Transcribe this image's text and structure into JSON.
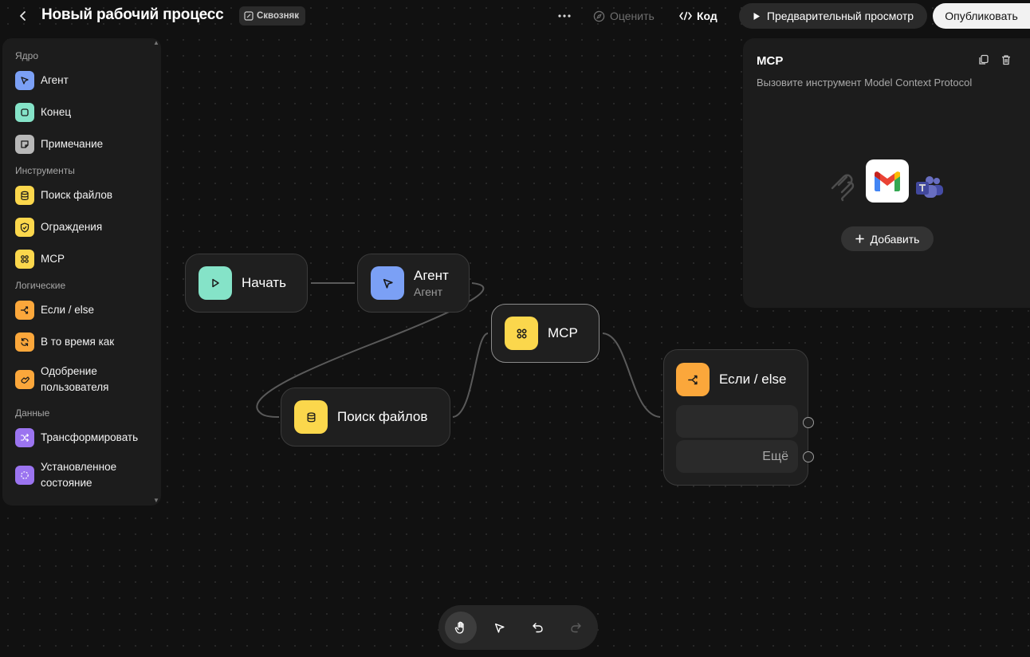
{
  "header": {
    "title": "Новый рабочий процесс",
    "badge": "Сквозняк",
    "rate_label": "Оценить",
    "code_label": "Код",
    "preview_label": "Предварительный просмотр",
    "publish_label": "Опубликовать"
  },
  "sidebar": {
    "sections": {
      "core": "Ядро",
      "tools": "Инструменты",
      "logic": "Логические",
      "data": "Данные"
    },
    "items": [
      {
        "label": "Агент",
        "icon": "cursor-icon",
        "color": "#7ba0f5"
      },
      {
        "label": "Конец",
        "icon": "stop-square-icon",
        "color": "#85e3c8"
      },
      {
        "label": "Примечание",
        "icon": "note-icon",
        "color": "#b8b8b8"
      },
      {
        "label": "Поиск файлов",
        "icon": "database-icon",
        "color": "#fbd74c"
      },
      {
        "label": "Ограждения",
        "icon": "shield-icon",
        "color": "#fbd74c"
      },
      {
        "label": "MCP",
        "icon": "mcp-icon",
        "color": "#fbd74c"
      },
      {
        "label": "Если / else",
        "icon": "branch-icon",
        "color": "#fba73b"
      },
      {
        "label": "В то время как",
        "icon": "loop-icon",
        "color": "#fba73b"
      },
      {
        "label_line1": "Одобрение",
        "label_line2": "пользователя",
        "icon": "approval-hand-icon",
        "color": "#fba73b"
      },
      {
        "label": "Трансформировать",
        "icon": "shuffle-icon",
        "color": "#9b74f0"
      },
      {
        "label_line1": "Установленное",
        "label_line2": "состояние",
        "icon": "state-circle-icon",
        "color": "#9b74f0"
      }
    ]
  },
  "canvas": {
    "nodes": {
      "start": {
        "title": "Начать"
      },
      "agent": {
        "title": "Агент",
        "subtitle": "Агент"
      },
      "mcp": {
        "title": "MCP"
      },
      "file_search": {
        "title": "Поиск файлов"
      },
      "if_else": {
        "title": "Если / else",
        "else_label": "Ещё"
      }
    }
  },
  "panel": {
    "title": "MCP",
    "description": "Вызовите инструмент Model Context Protocol",
    "add_label": "Добавить"
  }
}
